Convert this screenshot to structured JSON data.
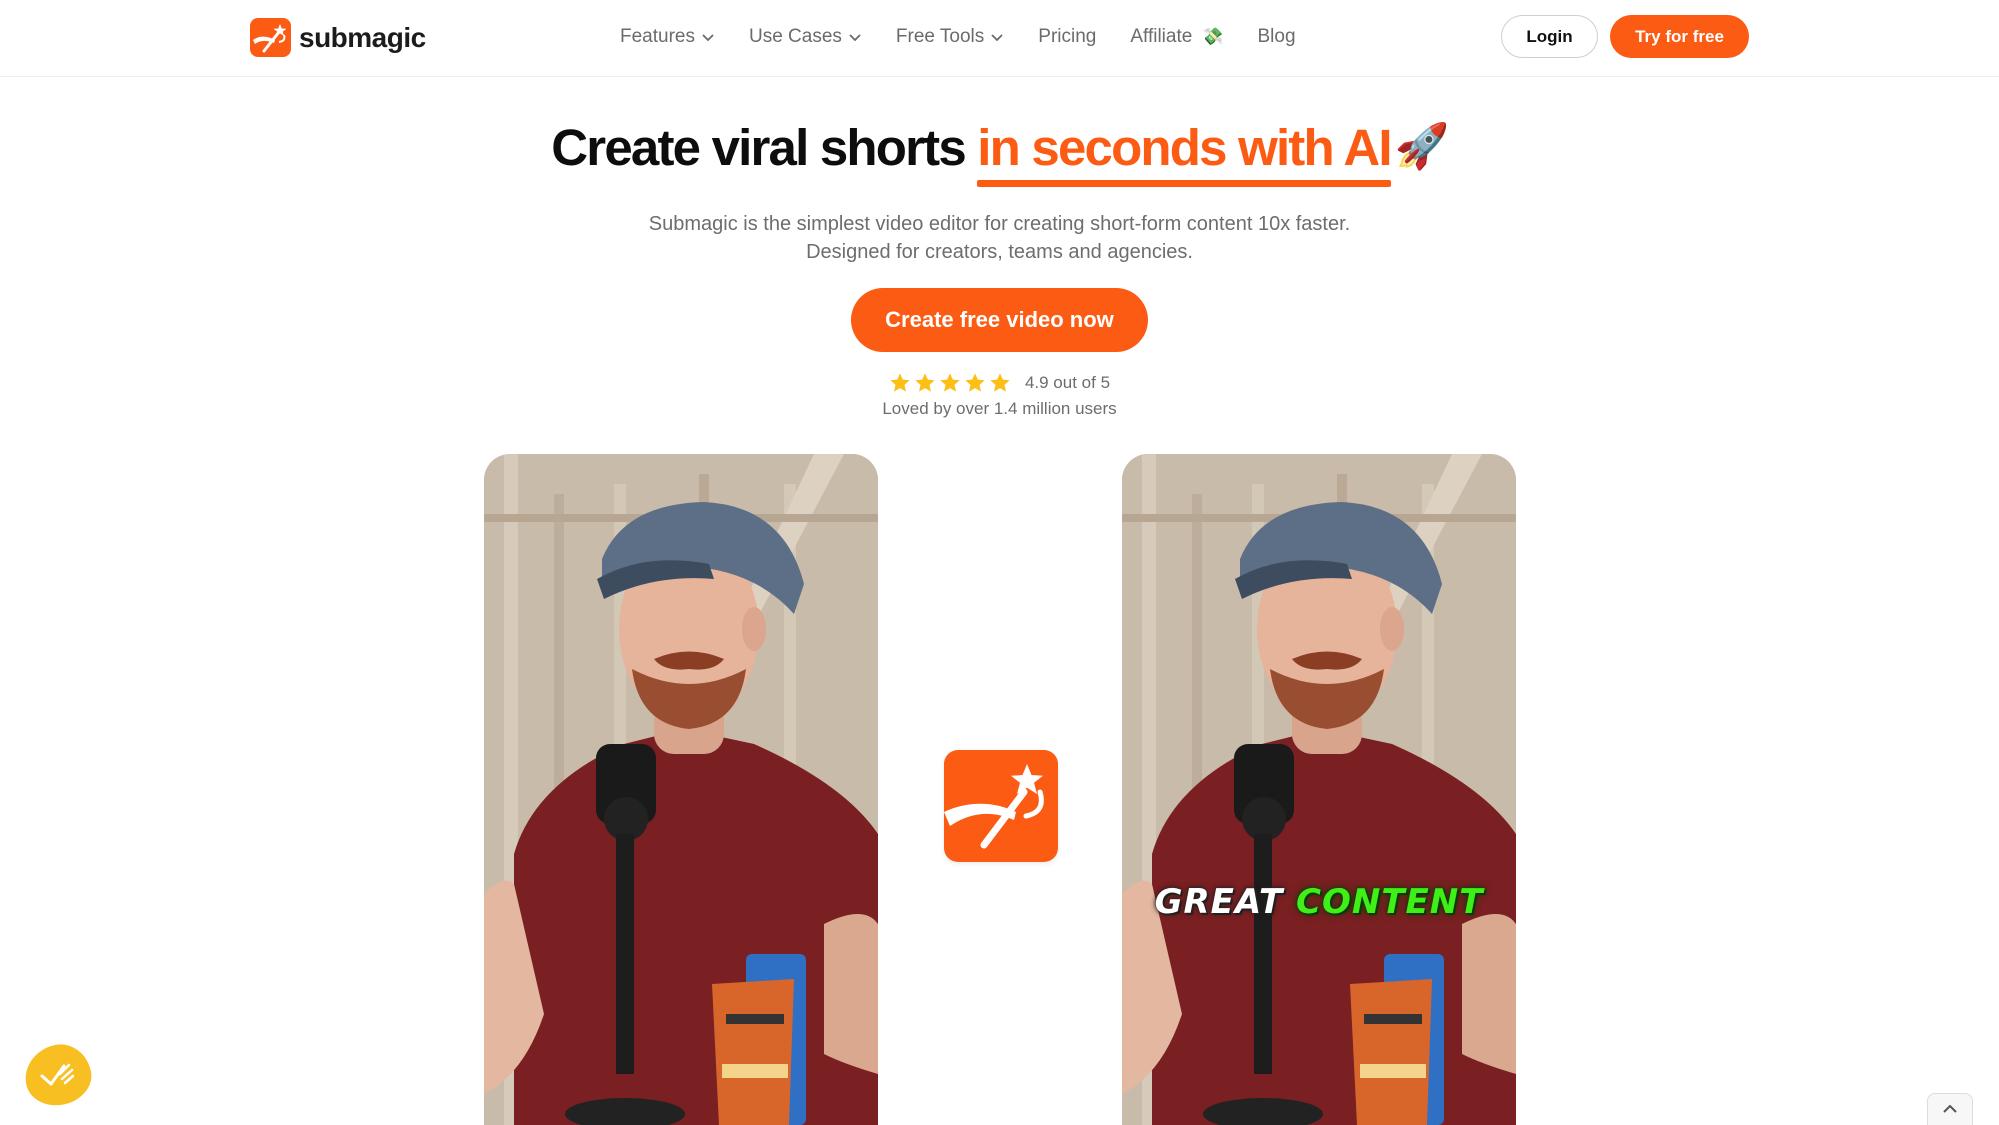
{
  "brand": {
    "name": "submagic",
    "accent_color": "#fb5b13",
    "logo_icon": "magic-wand-icon"
  },
  "nav": {
    "items": [
      {
        "label": "Features",
        "has_dropdown": true
      },
      {
        "label": "Use Cases",
        "has_dropdown": true
      },
      {
        "label": "Free Tools",
        "has_dropdown": true
      },
      {
        "label": "Pricing",
        "has_dropdown": false
      },
      {
        "label": "Affiliate",
        "has_dropdown": false,
        "emoji": "💸"
      },
      {
        "label": "Blog",
        "has_dropdown": false
      }
    ],
    "login_label": "Login",
    "try_label": "Try for free"
  },
  "hero": {
    "title_plain": "Create viral shorts",
    "title_accent": "in seconds with AI",
    "title_emoji": "🚀",
    "subtitle_line1": "Submagic is the simplest video editor for creating short-form content 10x faster.",
    "subtitle_line2": "Designed for creators, teams and agencies.",
    "cta_label": "Create free video now",
    "rating": {
      "stars": 5,
      "star_color": "#fbbf15",
      "text": "4.9 out of 5",
      "loved_text": "Loved by over 1.4 million users"
    }
  },
  "demo": {
    "before_label": "original-video",
    "after_label": "captioned-video",
    "caption_word1": "GREAT",
    "caption_word2": "CONTENT",
    "caption_highlight_color": "#3ef018"
  },
  "floating": {
    "badge_icon": "checkmark-hand-icon",
    "badge_color": "#f8bf22",
    "scroll_top_icon": "chevron-up-icon"
  }
}
